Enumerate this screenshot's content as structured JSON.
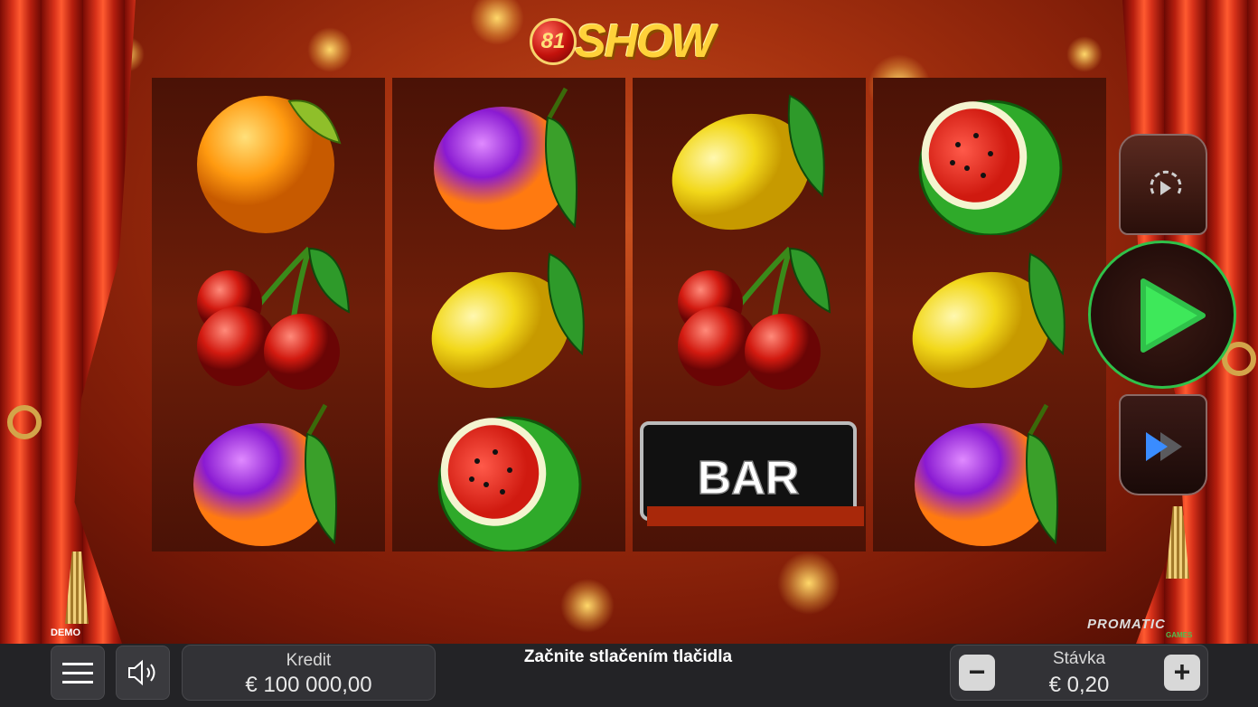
{
  "app": {
    "logo_number": "81",
    "logo_text": "SHOW",
    "demo_label": "DEMO",
    "brand": "PROMATIC",
    "brand_sub": "GAMES"
  },
  "reels": [
    [
      "orange",
      "cherry",
      "plum"
    ],
    [
      "plum",
      "lemon",
      "watermelon"
    ],
    [
      "lemon",
      "cherry",
      "bar"
    ],
    [
      "watermelon",
      "lemon",
      "plum"
    ]
  ],
  "symbols": {
    "bar_text": "BAR"
  },
  "controls": {
    "menu_icon": "hamburger-menu-icon",
    "sound_icon": "speaker-icon",
    "autoplay_icon": "autoplay-icon",
    "spin_icon": "play-icon",
    "turbo_icon": "fast-forward-icon"
  },
  "credit": {
    "label": "Kredit",
    "value": "€ 100 000,00"
  },
  "message": "Začnite stlačením tlačidla",
  "bet": {
    "label": "Stávka",
    "value": "€ 0,20",
    "minus": "−",
    "plus": "+"
  },
  "colors": {
    "spin_ring": "#2fc24a",
    "spin_arrow": "#3ee85a",
    "turbo_arrow": "#3a8cff",
    "bar_bg": "#232326"
  }
}
